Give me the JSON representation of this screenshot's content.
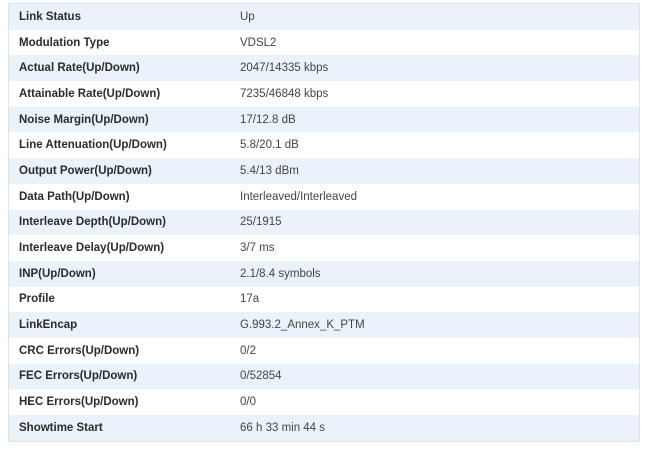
{
  "status_table": {
    "rows": [
      {
        "label": "Link Status",
        "value": "Up"
      },
      {
        "label": "Modulation Type",
        "value": "VDSL2"
      },
      {
        "label": "Actual Rate(Up/Down)",
        "value": "2047/14335 kbps"
      },
      {
        "label": "Attainable Rate(Up/Down)",
        "value": "7235/46848 kbps"
      },
      {
        "label": "Noise Margin(Up/Down)",
        "value": "17/12.8 dB"
      },
      {
        "label": "Line Attenuation(Up/Down)",
        "value": "5.8/20.1 dB"
      },
      {
        "label": "Output Power(Up/Down)",
        "value": "5.4/13 dBm"
      },
      {
        "label": "Data Path(Up/Down)",
        "value": "Interleaved/Interleaved"
      },
      {
        "label": "Interleave Depth(Up/Down)",
        "value": "25/1915"
      },
      {
        "label": "Interleave Delay(Up/Down)",
        "value": "3/7 ms"
      },
      {
        "label": "INP(Up/Down)",
        "value": "2.1/8.4 symbols"
      },
      {
        "label": "Profile",
        "value": "17a"
      },
      {
        "label": "LinkEncap",
        "value": "G.993.2_Annex_K_PTM"
      },
      {
        "label": "CRC Errors(Up/Down)",
        "value": "0/2"
      },
      {
        "label": "FEC Errors(Up/Down)",
        "value": "0/52854"
      },
      {
        "label": "HEC Errors(Up/Down)",
        "value": "0/0"
      },
      {
        "label": "Showtime Start",
        "value": "66 h 33 min 44 s"
      }
    ]
  },
  "colors": {
    "stripe": "#eaf3fb",
    "border": "#dfe3e8"
  }
}
